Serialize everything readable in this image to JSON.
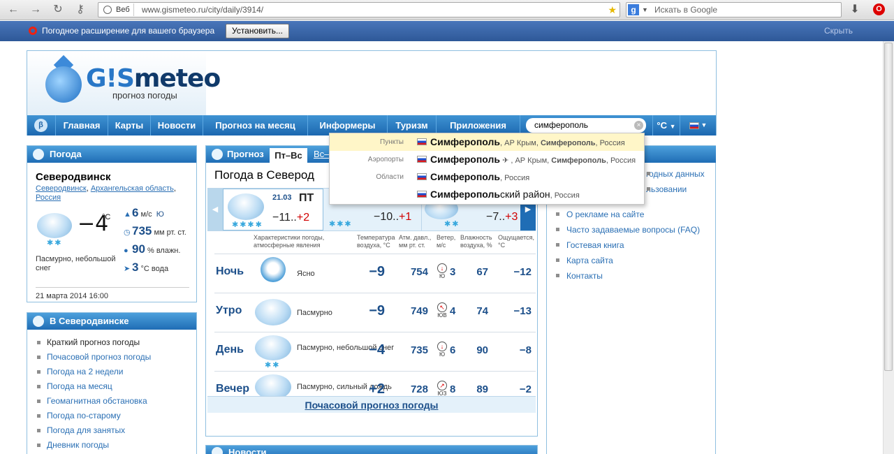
{
  "browser": {
    "url_prefix": "Веб",
    "url": "www.gismeteo.ru/city/daily/3914/",
    "search_placeholder": "Искать в Google",
    "notice_text": "Погодное расширение для вашего браузера",
    "notice_button": "Установить...",
    "notice_hide": "Скрыть"
  },
  "site": {
    "logo_gis": "G!S",
    "logo_meteo": "meteo",
    "logo_sub": "прогноз погоды",
    "nav": [
      "Главная",
      "Карты",
      "Новости",
      "Прогноз на месяц",
      "Информеры",
      "Туризм",
      "Приложения"
    ],
    "search_value": "симферополь",
    "unit": "°C"
  },
  "suggest": [
    {
      "cat": "Пункты",
      "name": "Симферополь",
      "tail_a": ", АР Крым, ",
      "tail_b": "Симферополь",
      "tail_c": ", Россия"
    },
    {
      "cat": "Аэропорты",
      "name": "Симферополь",
      "tail_a": " ✈ , АР Крым, ",
      "tail_b": "Симферополь",
      "tail_c": ", Россия"
    },
    {
      "cat": "Области",
      "name": "Симферополь",
      "tail_a": ", Россия",
      "tail_b": "",
      "tail_c": ""
    },
    {
      "cat": "",
      "name": "Симферополь",
      "tail_a": "ский район",
      "tail_b": "",
      "tail_c": ", Россия"
    }
  ],
  "weather": {
    "header": "Погода",
    "city": "Северодвинск",
    "reg_city": "Северодвинск",
    "reg_area": "Архангельская область",
    "reg_country": "Россия",
    "temp": "−4",
    "temp_unit": "°C",
    "desc": "Пасмурно, небольшой снег",
    "wind": "6",
    "wind_unit": "м/с",
    "wind_dir": "Ю",
    "pressure": "735",
    "pressure_unit": "мм рт. ст.",
    "humidity": "90",
    "humidity_unit": "% влажн.",
    "water": "3",
    "water_unit": "°C вода",
    "date": "21 марта 2014 16:00"
  },
  "in_city": {
    "header": "В Северодвинске",
    "items": [
      "Краткий прогноз погоды",
      "Почасовой прогноз погоды",
      "Погода на 2 недели",
      "Погода на месяц",
      "Геомагнитная обстановка",
      "Погода по-старому",
      "Погода для занятых",
      "Дневник погоды"
    ]
  },
  "forecast": {
    "tab_label": "Прогноз",
    "tab_active": "Пт–Вс",
    "tab_next": "Вс–",
    "title": "Погода в Северод",
    "day1_date": "21.03",
    "day1_name": "ПТ",
    "day1_min": "−11..",
    "day1_max": "+2",
    "day2_min": "−10..",
    "day2_max": "+1",
    "day3_min": "−7..",
    "day3_max": "+3",
    "col_headers": [
      "Характеристики погоды, атмосферные явления",
      "Температура воздуха, °С",
      "Атм. давл., мм рт. ст.",
      "Ветер, м/с",
      "Влажность воздуха, %",
      "Ощущается, °С"
    ],
    "rows": [
      {
        "period": "Ночь",
        "desc": "Ясно",
        "temp": "−9",
        "press": "754",
        "wind": "3",
        "wind_dir": "Ю",
        "hum": "67",
        "feels": "−12"
      },
      {
        "period": "Утро",
        "desc": "Пасмурно",
        "temp": "−9",
        "press": "749",
        "wind": "4",
        "wind_dir": "ЮВ",
        "hum": "74",
        "feels": "−13"
      },
      {
        "period": "День",
        "desc": "Пасмурно, небольшой снег",
        "temp": "−4",
        "press": "735",
        "wind": "6",
        "wind_dir": "Ю",
        "hum": "90",
        "feels": "−8"
      },
      {
        "period": "Вечер",
        "desc": "Пасмурно, сильный дождь",
        "temp": "+2",
        "press": "728",
        "wind": "8",
        "wind_dir": "ЮЗ",
        "hum": "89",
        "feels": "−2"
      }
    ],
    "hourly_link": "Почасовой прогноз погоды",
    "news_header": "Новости"
  },
  "right_links": [
    "годных данных",
    "льзовании",
    "О рекламе на сайте",
    "Часто задаваемые вопросы (FAQ)",
    "Гостевая книга",
    "Карта сайта",
    "Контакты"
  ]
}
